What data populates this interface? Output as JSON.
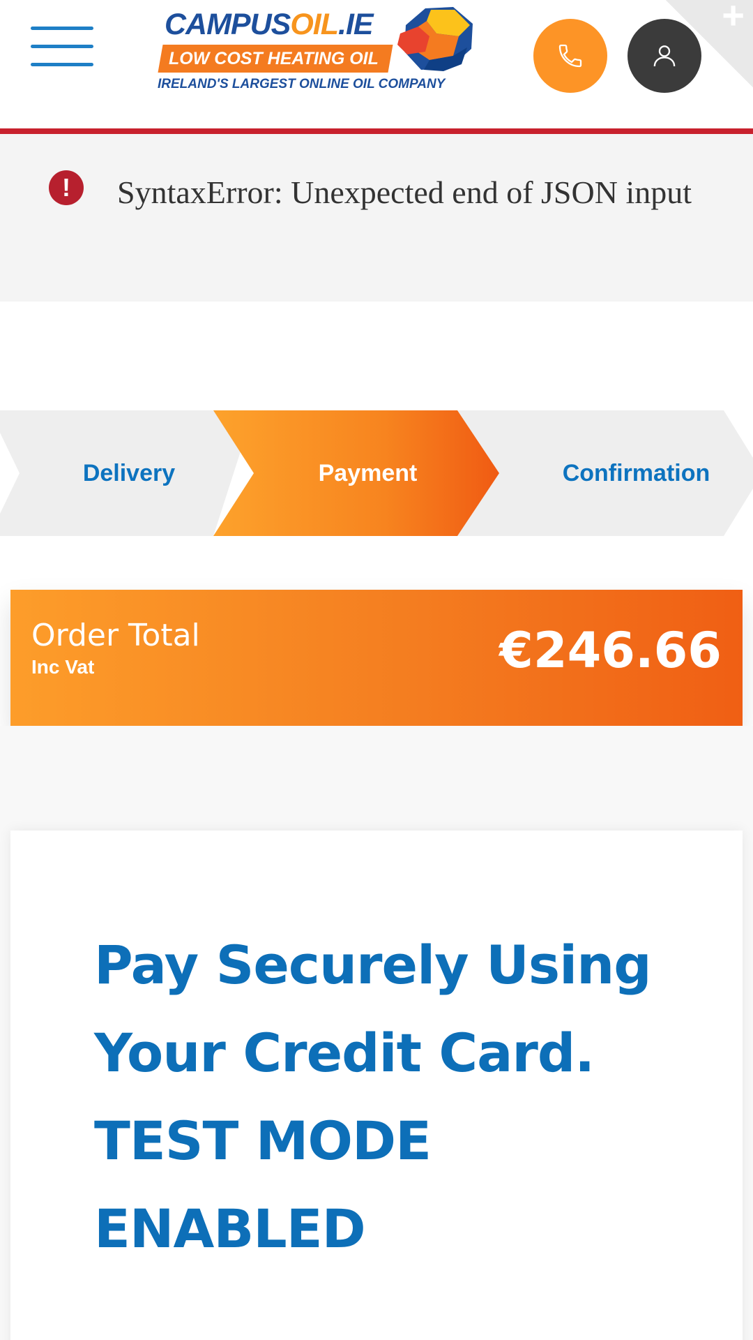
{
  "header": {
    "menu_icon": "hamburger-menu-icon",
    "logo": {
      "brand_part1": "CAMPUS",
      "brand_part2": "OIL",
      "brand_part3": ".IE",
      "tagline": "LOW COST HEATING OIL",
      "subtitle": "IRELAND'S LARGEST ONLINE OIL COMPANY"
    },
    "phone_icon": "phone-icon",
    "account_icon": "user-icon",
    "corner_icon": "plus-icon"
  },
  "error": {
    "icon": "exclamation-circle-icon",
    "message": "SyntaxError: Unexpected end of JSON input"
  },
  "steps": [
    {
      "label": "Delivery",
      "state": "inactive"
    },
    {
      "label": "Payment",
      "state": "active"
    },
    {
      "label": "Confirmation",
      "state": "inactive"
    }
  ],
  "order_total": {
    "label": "Order Total",
    "sublabel": "Inc Vat",
    "amount": "€246.66"
  },
  "payment": {
    "title_line1": "Pay Securely Using",
    "title_line2": "Your Credit Card.",
    "title_line3": "TEST MODE",
    "title_line4": "ENABLED"
  },
  "colors": {
    "brand_blue": "#0d6fb8",
    "brand_orange": "#f47b20",
    "rule_red": "#c8212d",
    "error_red": "#b7202e",
    "account_dark": "#3b3b3b"
  }
}
